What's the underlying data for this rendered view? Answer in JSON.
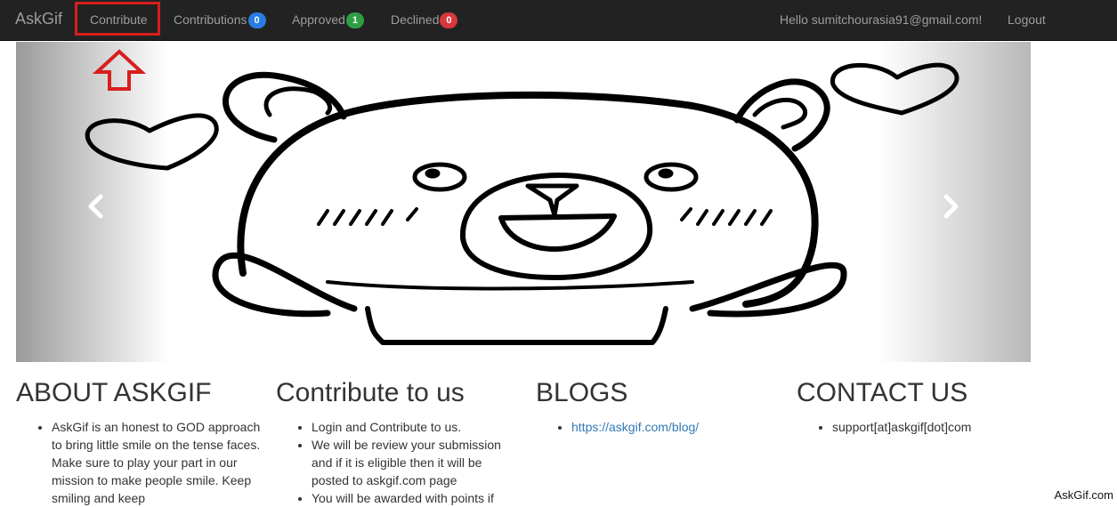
{
  "navbar": {
    "brand": "AskGif",
    "items": [
      {
        "label": "Contribute"
      },
      {
        "label": "Contributions",
        "badge": "0",
        "badge_color": "#2a7be4"
      },
      {
        "label": "Approved",
        "badge": "1",
        "badge_color": "#2e9e44"
      },
      {
        "label": "Declined",
        "badge": "0",
        "badge_color": "#d9363e"
      }
    ],
    "greeting": "Hello sumitchourasia91@gmail.com!",
    "logout": "Logout"
  },
  "carousel": {
    "prev_icon": "chevron-left-icon",
    "next_icon": "chevron-right-icon"
  },
  "sections": {
    "about": {
      "title": "ABOUT ASKGIF",
      "items": [
        "AskGif is an honest to GOD approach to bring little smile on the tense faces. Make sure to play your part in our mission to make people smile. Keep smiling and keep"
      ]
    },
    "contribute": {
      "title": "Contribute to us",
      "items": [
        "Login and Contribute to us.",
        "We will be review your submission and if it is eligible then it will be posted to askgif.com page",
        "You will be awarded with points if"
      ]
    },
    "blogs": {
      "title": "BLOGS",
      "link": "https://askgif.com/blog/"
    },
    "contact": {
      "title": "CONTACT US",
      "email": "support[at]askgif[dot]com"
    }
  },
  "watermark": "AskGif.com",
  "colors": {
    "navbar_bg": "#222222",
    "highlight": "#d81e1e",
    "link": "#337ab7"
  }
}
